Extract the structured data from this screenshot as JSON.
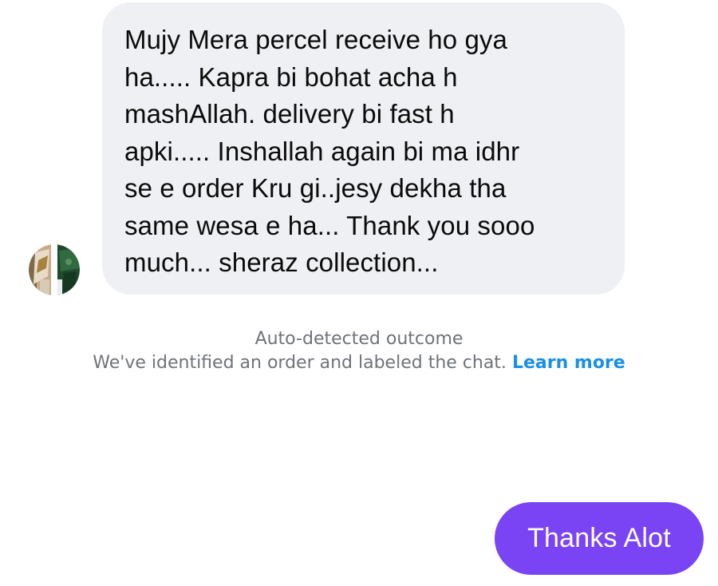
{
  "conversation": {
    "incoming_message": {
      "lines": [
        "Mujy Mera percel receive ho gya",
        "ha..... Kapra bi bohat acha h",
        "mashAllah. delivery bi fast h",
        "apki..... Inshallah again bi ma idhr",
        "se e order Kru gi..jesy dekha tha",
        "same wesa e ha... Thank you sooo",
        "much... sheraz collection..."
      ]
    },
    "system_notice": {
      "title": "Auto-detected outcome",
      "description": "We've identified an order and labeled the chat.",
      "link_label": "Learn more"
    },
    "outgoing_message": {
      "text": "Thanks Alot"
    }
  },
  "colors": {
    "incoming_bubble": "#eff0f4",
    "outgoing_bubble": "#7a44f4",
    "link": "#1a8fe6",
    "notice_text": "#6f7378"
  },
  "icons": {
    "avatar": "sender-profile-photo"
  }
}
